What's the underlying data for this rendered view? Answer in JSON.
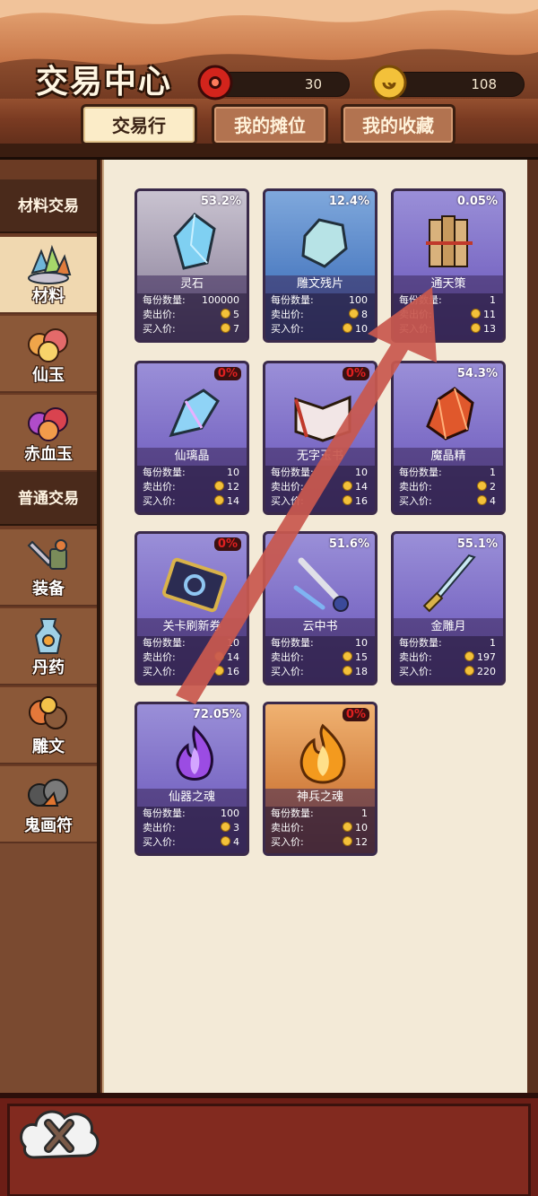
{
  "header": {
    "title": "交易中心",
    "resources": [
      {
        "icon": "spirit-stone-icon",
        "value": "30"
      },
      {
        "icon": "gold-coin-icon",
        "value": "108"
      }
    ],
    "tabs": [
      {
        "label": "交易行",
        "active": true
      },
      {
        "label": "我的摊位",
        "active": false
      },
      {
        "label": "我的收藏",
        "active": false
      }
    ]
  },
  "sidebar": {
    "sections": [
      {
        "label": "材料交易"
      },
      {
        "label": "普通交易"
      }
    ],
    "items": [
      {
        "label": "材料",
        "icon": "materials-icon",
        "active": true
      },
      {
        "label": "仙玉",
        "icon": "jade-icon",
        "active": false
      },
      {
        "label": "赤血玉",
        "icon": "blood-jade-icon",
        "active": false
      },
      {
        "label": "装备",
        "icon": "equipment-icon",
        "active": false
      },
      {
        "label": "丹药",
        "icon": "pill-icon",
        "active": false
      },
      {
        "label": "雕文",
        "icon": "glyph-icon",
        "active": false
      },
      {
        "label": "鬼画符",
        "icon": "talisman-icon",
        "active": false
      }
    ]
  },
  "labels": {
    "qty": "每份数量:",
    "sell": "卖出价:",
    "buy": "买入价:"
  },
  "cards": [
    {
      "name": "灵石",
      "pct": "53.2%",
      "qty": "100000",
      "sell": "5",
      "buy": "7",
      "theme": "grey",
      "icon": "crystal-icon"
    },
    {
      "name": "雕文残片",
      "pct": "12.4%",
      "qty": "100",
      "sell": "8",
      "buy": "10",
      "theme": "blue",
      "icon": "stone-fragment-icon"
    },
    {
      "name": "通天策",
      "pct": "0.05%",
      "qty": "1",
      "sell": "11",
      "buy": "13",
      "theme": "purple",
      "icon": "scroll-bundle-icon"
    },
    {
      "name": "仙璃晶",
      "pct": "0%",
      "qty": "10",
      "sell": "12",
      "buy": "14",
      "theme": "purple",
      "icon": "crystal-shard-icon"
    },
    {
      "name": "无字玉书",
      "pct": "0%",
      "qty": "10",
      "sell": "14",
      "buy": "16",
      "theme": "purple",
      "icon": "book-icon"
    },
    {
      "name": "魔晶精",
      "pct": "54.3%",
      "qty": "1",
      "sell": "2",
      "buy": "4",
      "theme": "purple",
      "icon": "magic-crystal-icon"
    },
    {
      "name": "关卡刷新券",
      "pct": "0%",
      "qty": "10",
      "sell": "14",
      "buy": "16",
      "theme": "purple",
      "icon": "refresh-ticket-icon"
    },
    {
      "name": "云中书",
      "pct": "51.6%",
      "qty": "10",
      "sell": "15",
      "buy": "18",
      "theme": "purple",
      "icon": "brush-icon"
    },
    {
      "name": "金雕月",
      "pct": "55.1%",
      "qty": "1",
      "sell": "197",
      "buy": "220",
      "theme": "purple",
      "icon": "dagger-icon"
    },
    {
      "name": "仙器之魂",
      "pct": "72.05%",
      "qty": "100",
      "sell": "3",
      "buy": "4",
      "theme": "purple",
      "icon": "purple-flame-icon"
    },
    {
      "name": "神兵之魂",
      "pct": "0%",
      "qty": "1",
      "sell": "10",
      "buy": "12",
      "theme": "orange",
      "icon": "fire-soul-icon"
    }
  ],
  "footer": {
    "close_icon": "close-icon"
  },
  "colors": {
    "accent": "#c8584f",
    "zero_pct": "#e02020",
    "coin": "#f3c13a"
  }
}
